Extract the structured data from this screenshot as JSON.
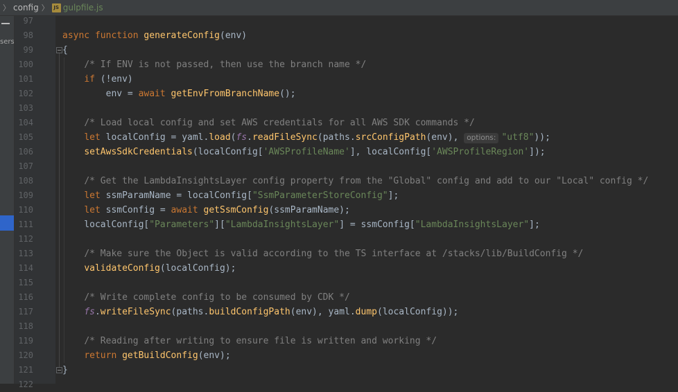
{
  "breadcrumb": {
    "folder": "config",
    "file": "gulpfile.js",
    "file_icon": "JS"
  },
  "sidebar": {
    "partial_label": "sers"
  },
  "editor": {
    "lines": [
      {
        "n": "97",
        "code": ""
      },
      {
        "n": "98",
        "code": "async function generateConfig(env)"
      },
      {
        "n": "99",
        "code": "{"
      },
      {
        "n": "100",
        "code": "    /* If ENV is not passed, then use the branch name */"
      },
      {
        "n": "101",
        "code": "    if (!env)"
      },
      {
        "n": "102",
        "code": "        env = await getEnvFromBranchName();"
      },
      {
        "n": "103",
        "code": ""
      },
      {
        "n": "104",
        "code": "    /* Load local config and set AWS credentials for all AWS SDK commands */"
      },
      {
        "n": "105",
        "code": "    let localConfig = yaml.load(fs.readFileSync(paths.srcConfigPath(env), options: \"utf8\"));"
      },
      {
        "n": "106",
        "code": "    setAwsSdkCredentials(localConfig['AWSProfileName'], localConfig['AWSProfileRegion']);"
      },
      {
        "n": "107",
        "code": ""
      },
      {
        "n": "108",
        "code": "    /* Get the LambdaInsightsLayer config property from the \"Global\" config and add to our \"Local\" config */"
      },
      {
        "n": "109",
        "code": "    let ssmParamName = localConfig[\"SsmParameterStoreConfig\"];"
      },
      {
        "n": "110",
        "code": "    let ssmConfig = await getSsmConfig(ssmParamName);"
      },
      {
        "n": "111",
        "code": "    localConfig[\"Parameters\"][\"LambdaInsightsLayer\"] = ssmConfig[\"LambdaInsightsLayer\"];"
      },
      {
        "n": "112",
        "code": ""
      },
      {
        "n": "113",
        "code": "    /* Make sure the Object is valid according to the TS interface at /stacks/lib/BuildConfig */"
      },
      {
        "n": "114",
        "code": "    validateConfig(localConfig);"
      },
      {
        "n": "115",
        "code": ""
      },
      {
        "n": "116",
        "code": "    /* Write complete config to be consumed by CDK */"
      },
      {
        "n": "117",
        "code": "    fs.writeFileSync(paths.buildConfigPath(env), yaml.dump(localConfig));"
      },
      {
        "n": "118",
        "code": ""
      },
      {
        "n": "119",
        "code": "    /* Reading after writing to ensure file is written and working */"
      },
      {
        "n": "120",
        "code": "    return getBuildConfig(env);"
      },
      {
        "n": "121",
        "code": "}"
      },
      {
        "n": "122",
        "code": ""
      }
    ],
    "param_hint": "options:"
  },
  "colors": {
    "background": "#2b2b2b",
    "keyword": "#cc7832",
    "function": "#ffc66d",
    "comment": "#808080",
    "string": "#6a8759",
    "field": "#9876aa"
  }
}
